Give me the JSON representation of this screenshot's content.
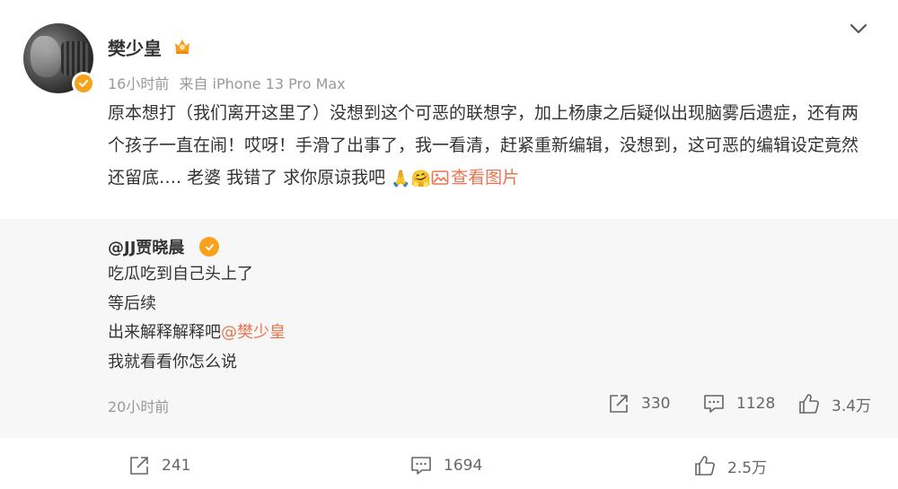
{
  "post": {
    "author": "樊少皇",
    "time": "16小时前",
    "source": "来自 iPhone 13 Pro Max",
    "content": "原本想打（我们离开这里了）没想到这个可恶的联想字，加上杨康之后疑似出现脑雾后遗症，还有两个孩子一直在闹！哎呀！手滑了出事了，我一看清，赶紧重新编辑，没想到，这可恶的编辑设定竟然还留底…. 老婆 我错了 求你原谅我吧",
    "emoji_1": "🙏",
    "emoji_2": "🤗",
    "view_pictures": "查看图片"
  },
  "retweet": {
    "author": "@JJ贾晓晨",
    "lines": [
      "吃瓜吃到自己头上了",
      "等后续",
      "出来解释解释吧",
      "我就看看你怎么说"
    ],
    "mention": "@樊少皇",
    "time": "20小时前",
    "reposts": "330",
    "comments": "1128",
    "likes": "3.4万"
  },
  "actions": {
    "reposts": "241",
    "comments": "1694",
    "likes": "2.5万"
  },
  "colors": {
    "accent": "#eb7350",
    "verified": "#f7a21c",
    "retweet_bg": "#f7f7f7",
    "meta_text": "#999999"
  },
  "icons": [
    "avatar",
    "verified-icon",
    "vip-badge-icon",
    "chevron-down-icon",
    "picture-icon",
    "repost-icon",
    "comment-icon",
    "like-icon"
  ]
}
